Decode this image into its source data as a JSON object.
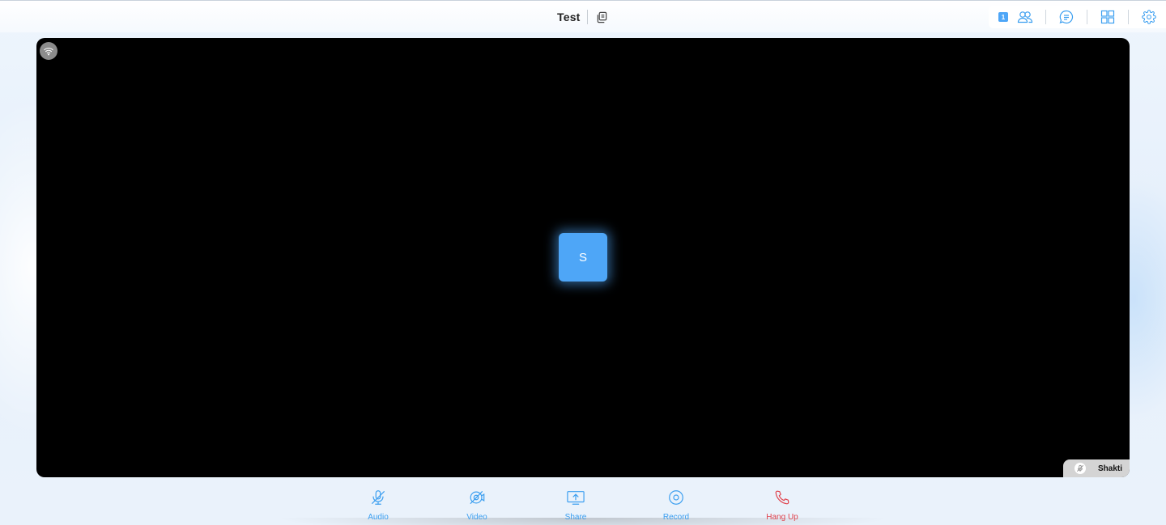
{
  "header": {
    "title": "Test",
    "participant_count": "1"
  },
  "stage": {
    "avatar_initial": "S",
    "participant_name": "Shakti"
  },
  "toolbar": {
    "audio_label": "Audio",
    "video_label": "Video",
    "share_label": "Share",
    "record_label": "Record",
    "hangup_label": "Hang Up"
  },
  "colors": {
    "accent": "#4ea6f7",
    "danger": "#e0424c",
    "stage_bg": "#000000"
  }
}
